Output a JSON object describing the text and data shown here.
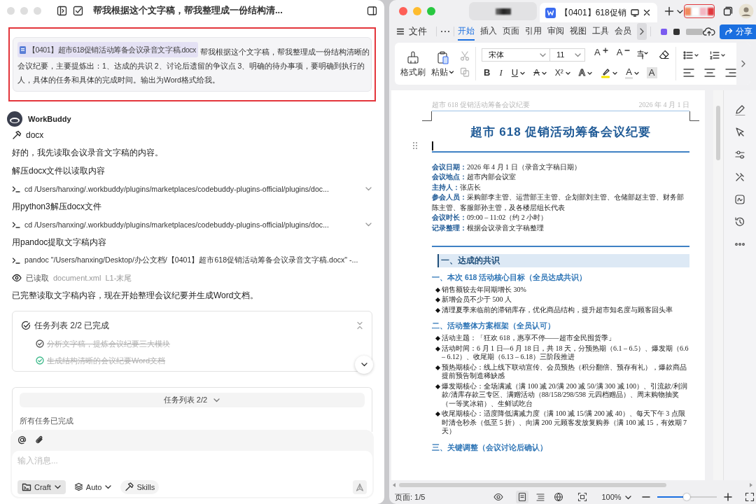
{
  "chat": {
    "title": "帮我根据这个文字稿，帮我整理成一份结构清...",
    "user_message": {
      "attachment": "【0401】超市618促销活动筹备会议录音文字稿.docx",
      "text": "帮我根据这个文字稿，帮我整理成一份结构清晰的",
      "text_continued": "会议纪要，主要提炼出：1、达成的共识 2、讨论后遗留的争议点 3、明确的待办事项，要明确到执行的人，具体的任务和具体的完成时间。输出为Word格式给我。",
      "highlighted": true
    },
    "assistant": {
      "name": "WorkBuddy",
      "skill": "docx"
    },
    "steps": [
      {
        "kind": "text",
        "text": "好的，我先读取会议录音文字稿的内容。"
      },
      {
        "kind": "text",
        "text": "解压docx文件以读取内容"
      },
      {
        "kind": "command",
        "text": "cd /Users/hanxing/.workbuddy/plugins/marketplaces/codebuddy-plugins-official/plugins/doc...",
        "expandable": true
      },
      {
        "kind": "text",
        "text": "用python3解压docx文件"
      },
      {
        "kind": "command",
        "text": "cd /Users/hanxing/.workbuddy/plugins/marketplaces/codebuddy-plugins-official/plugins/doc...",
        "expandable": true
      },
      {
        "kind": "text",
        "text": "用pandoc提取文字稿内容"
      },
      {
        "kind": "command",
        "text": "pandoc \"/Users/hanxing/Desktop/办公文档/【0401】超市618促销活动筹备会议录音文字稿.docx\" -...",
        "expandable": false
      },
      {
        "kind": "read",
        "label": "已读取",
        "file": "document.xml",
        "range": "L1-末尾"
      },
      {
        "kind": "text",
        "text": "已完整读取文字稿内容，现在开始整理会议纪要并生成Word文档。"
      }
    ],
    "task_card": {
      "title": "任务列表 2/2 已完成",
      "expanded": true,
      "tasks": [
        {
          "text": "分析文字稿，提炼会议纪要三大模块",
          "done": true,
          "color": "#555555"
        },
        {
          "text": "生成结构清晰的会议纪要Word文档",
          "done": true,
          "color": "#3cb98a"
        }
      ]
    },
    "task_panel": {
      "toggle": "任务列表 2/2",
      "summary": "所有任务已完成"
    },
    "composer": {
      "placeholder": "输入消息...",
      "mode": "Craft",
      "model": "Auto",
      "skills": "Skills"
    }
  },
  "editor": {
    "tabs": [
      {
        "label": "【0401】618促销",
        "selected": true
      }
    ],
    "file_menu": "文件",
    "ribbon_tabs": [
      {
        "label": "开始",
        "selected": true
      },
      {
        "label": "插入",
        "selected": false
      },
      {
        "label": "页面",
        "selected": false
      },
      {
        "label": "引用",
        "selected": false
      },
      {
        "label": "审阅",
        "selected": false
      },
      {
        "label": "视图",
        "selected": false
      },
      {
        "label": "工具",
        "selected": false
      },
      {
        "label": "会员",
        "selected": false
      }
    ],
    "share": "分享",
    "clipboard": {
      "format_painter": "格式刷",
      "paste": "粘贴"
    },
    "font": {
      "family": "宋体",
      "size": "11"
    },
    "size_buttons": [
      {
        "glyph": "A",
        "kind": "grow"
      },
      {
        "glyph": "A",
        "kind": "shrink"
      }
    ],
    "format_buttons": [
      {
        "glyph": "B",
        "kind": "bold",
        "caret": false
      },
      {
        "glyph": "I",
        "kind": "italic",
        "caret": false
      },
      {
        "glyph": "U",
        "kind": "underline",
        "caret": true
      },
      {
        "glyph": "A",
        "kind": "strike",
        "caret": true
      },
      {
        "glyph": "X²",
        "kind": "superscript",
        "caret": true
      },
      {
        "glyph": "A",
        "kind": "outline",
        "caret": true
      },
      {
        "kind": "highlight",
        "caret": true
      },
      {
        "glyph": "A",
        "kind": "color",
        "caret": true
      },
      {
        "glyph": "A",
        "kind": "shading",
        "caret": false
      }
    ],
    "document": {
      "header_left": "超市 618 促销活动筹备会议纪要",
      "header_right": "2026 年 4 月 1 日",
      "title": "超市 618 促销活动筹备会议纪要",
      "meta": [
        "**会议日期：**2026 年 4 月 1 日（录音文字稿日期）",
        "**会议地点：**超市内部会议室",
        "**主持人：**张店长",
        "**参会人员：**采购部李主管、运营部王主管、企划部刘主管、仓储部赵主管、财务部陈主管、客服部孙主管，及各楼层组长代表",
        "**会议时长：**09:00 – 11:02（约 2 小时）",
        "**记录整理：**根据会议录音文字稿整理"
      ],
      "sections": [
        {
          "heading": "一、达成的共识",
          "subsections": [
            {
              "heading": "一、本次 618 活动核心目标（全员达成共识）",
              "bullets": [
                "销售额较去年同期增长 30%",
                "新增会员不少于 500 人",
                "清理夏季来临前的滞销库存，优化商品结构，提升超市知名度与顾客回头率"
              ]
            },
            {
              "heading": "二、活动整体方案框架（全员认可）",
              "bullets": [
                "活动主题：「狂欢 618，惠享不停——超市全民囤货季」",
                "活动时间：6 月 1 日—6 月 18 日，共 18 天，分预热期（6.1 – 6.5）、爆发期（6.6 – 6.12）、收尾期（6.13 – 6.18）三阶段推进",
                "预热期核心：线上线下联动宣传、会员预热（积分翻倍、预存有礼），爆款商品提前预告制造稀缺感",
                "爆发期核心：全场满减（满 100 减 20/满 200 减 50/满 300 减 100）、引流款/利润款/清库存款三专区、满赠活动（88/158/298/598 元四档赠品）、周末购物抽奖（一等奖冰箱）、生鲜试吃台",
                "收尾期核心：适度降低满减力度（满 100 减 15/满 200 减 40）、每天下午 3 点限时清仓秒杀（低至 5 折）、向满 200 元顾客发放复购券（满 100 减 15，有效期 7 天）"
              ]
            },
            {
              "heading": "三、关键调整（会议讨论后确认）"
            }
          ]
        }
      ]
    },
    "status": {
      "page": "页面: 1/5",
      "zoom": "100%",
      "zoom_slider": {
        "level": 0.5
      }
    }
  }
}
